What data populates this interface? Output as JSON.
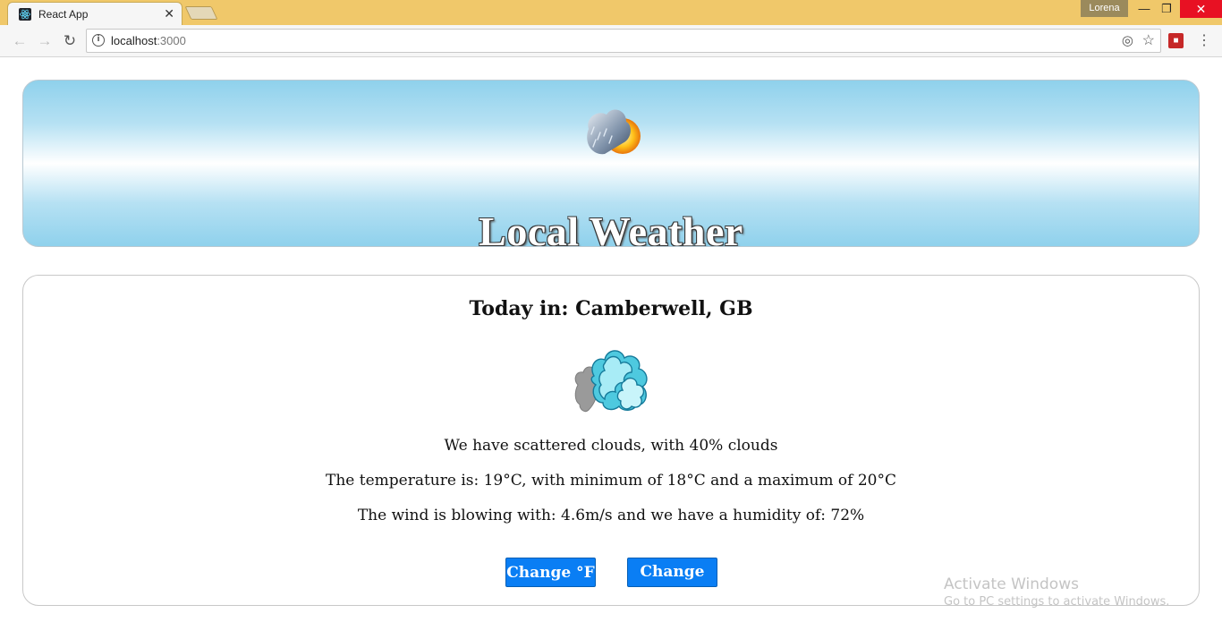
{
  "browser": {
    "tab_title": "React App",
    "tab_close": "✕",
    "profile_name": "Lorena",
    "url_host": "localhost",
    "url_port": ":3000",
    "window_controls": {
      "minimize": "—",
      "restore": "❐",
      "close": "✕"
    }
  },
  "header": {
    "title": "Local Weather",
    "icon": "sun-with-rain-cloud-icon"
  },
  "weather": {
    "location_label": "Today in: Camberwell, GB",
    "icon": "scattered-clouds-icon",
    "description": "We have scattered clouds, with 40% clouds",
    "temperature": "The temperature is: 19°C, with minimum of 18°C and a maximum of 20°C",
    "wind_humidity": "The wind is blowing with: 4.6m/s and we have a humidity of: 72%"
  },
  "buttons": {
    "fahrenheit": "Change °F",
    "celsius": "Change °C"
  },
  "watermark": {
    "title": "Activate Windows",
    "subtitle": "Go to PC settings to activate Windows."
  },
  "colors": {
    "titlebar": "#f0c86a",
    "button_blue": "#0a7ef4",
    "banner_sky": "#8fd1ec"
  }
}
